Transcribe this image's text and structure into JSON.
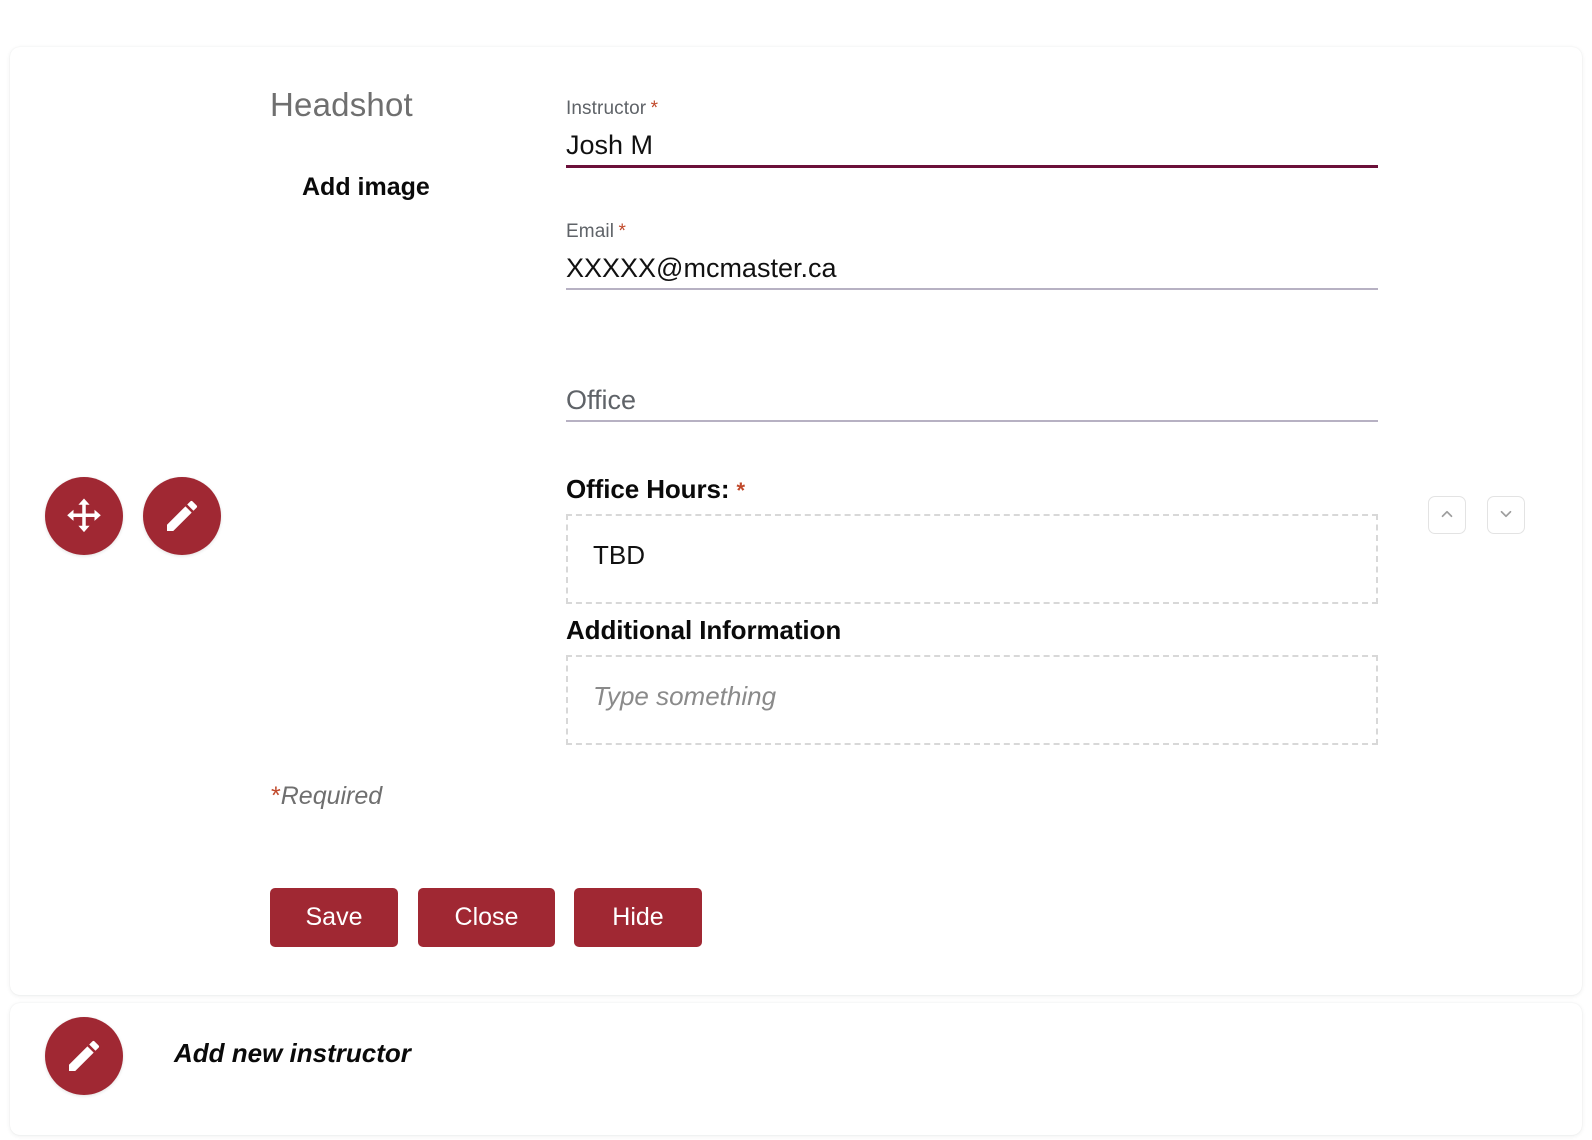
{
  "colors": {
    "brand_red": "#a02833",
    "active_underline": "#6b1039",
    "inactive_underline": "#b7b1c3",
    "required_star": "#c0492b",
    "label_gray": "#5f6368",
    "dashed_border": "#d8d8d8"
  },
  "headshot": {
    "title": "Headshot",
    "add_image_label": "Add image"
  },
  "controls": {
    "move_handle_icon": "move-arrows-icon",
    "edit_icon": "pencil-icon",
    "move_up_icon": "chevron-up-icon",
    "move_down_icon": "chevron-down-icon"
  },
  "form": {
    "instructor": {
      "label": "Instructor",
      "required_marker": "*",
      "value": "Josh M",
      "placeholder": "Instructor"
    },
    "email": {
      "label": "Email",
      "required_marker": "*",
      "value": "XXXXX@mcmaster.ca",
      "placeholder": "Email"
    },
    "office": {
      "label": "",
      "value": "",
      "placeholder": "Office"
    },
    "office_hours": {
      "heading": "Office Hours:",
      "required_marker": "*",
      "value": "TBD"
    },
    "additional_information": {
      "heading": "Additional Information",
      "value": "",
      "placeholder": "Type something"
    },
    "required_note": {
      "star": "*",
      "text": "Required"
    }
  },
  "actions": {
    "save_label": "Save",
    "close_label": "Close",
    "hide_label": "Hide"
  },
  "add_new_instructor": {
    "label": "Add new instructor",
    "icon": "pencil-icon"
  }
}
